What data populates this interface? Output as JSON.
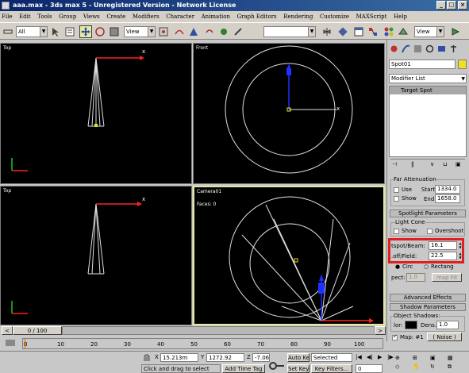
{
  "window": {
    "title": "aaa.max - 3ds max 5 - Unregistered Version - Network License"
  },
  "menu": [
    "File",
    "Edit",
    "Tools",
    "Group",
    "Views",
    "Create",
    "Modifiers",
    "Character",
    "Animation",
    "Graph Editors",
    "Rendering",
    "Customize",
    "MAXScript",
    "Help"
  ],
  "toolbar": {
    "selection_filter": "All",
    "ref_coord": "View",
    "named_selection": "",
    "view_dropdown_right": "View"
  },
  "viewports": {
    "top_left": {
      "label": "Top"
    },
    "top_right": {
      "label": "Front"
    },
    "bottom_left": {
      "label": "Top"
    },
    "bottom_right": {
      "label": "Camera01",
      "faces": "Faces: 0"
    },
    "axis_label": "x"
  },
  "panel": {
    "object_name": "Spot01",
    "modifier_list": "Modifier List",
    "stack_item": "Target Spot",
    "far_attenuation": {
      "title": "Far Attenuation",
      "use": "Use",
      "show": "Show",
      "start_label": "Start:",
      "start_value": "1334.0",
      "end_label": "End:",
      "end_value": "1658.0"
    },
    "spotlight_params": {
      "title": "Spotlight Parameters",
      "light_cone": "Light Cone",
      "show": "Show",
      "overshoot": "Overshoot",
      "hotspot_label": "tspot/Beam:",
      "hotspot_value": "16.1",
      "falloff_label": ".off/Field:",
      "falloff_value": "22.5",
      "circle": "Circ",
      "rectangle": "Rectang",
      "aspect_label": "pect:",
      "aspect_value": "1.0",
      "bitmap_fit": "map Fit"
    },
    "advanced_effects": "Advanced Effects",
    "shadow_params": {
      "title": "Shadow Parameters",
      "object_shadows": "Object Shadows:",
      "color_label": "lor:",
      "dens_label": "Dens.",
      "dens_value": "1.0",
      "map_label": "Map: #1",
      "map_value": "( Noise )"
    }
  },
  "time": {
    "slider_label": "0 / 100",
    "ticks": [
      "0",
      "10",
      "20",
      "30",
      "40",
      "50",
      "60",
      "70",
      "80",
      "90",
      "100"
    ]
  },
  "status": {
    "x_label": "X",
    "x_value": "15.213m",
    "y_label": "Y",
    "y_value": "1272.92",
    "z_label": "Z",
    "z_value": "-7.069",
    "prompt": "Click and drag to select",
    "add_time_tag": "Add Time Tag",
    "auto_key": "Auto Key",
    "set_key": "Set Key",
    "selected": "Selected",
    "key_filters": "Key Filters...",
    "frame_value": "0"
  },
  "colors": {
    "highlight": "#e02020",
    "active_viewport": "#e6e6a0",
    "wire": "#e0e0e0",
    "light_yellow": "#e8e020",
    "target_blue": "#2030ff",
    "axis_red": "#ff2020"
  }
}
